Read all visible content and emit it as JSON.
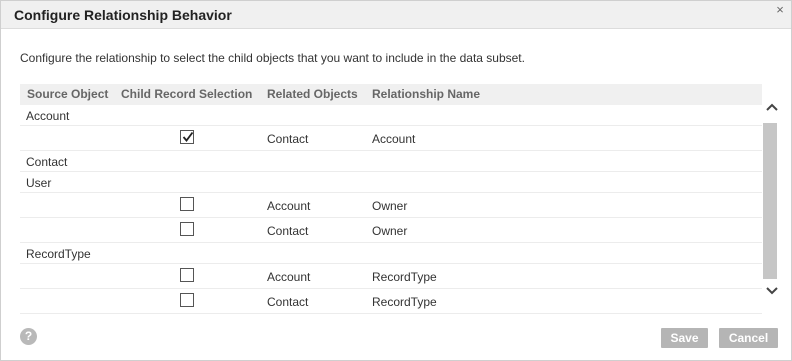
{
  "dialog": {
    "title": "Configure Relationship Behavior",
    "close_glyph": "×",
    "description": "Configure the relationship to select the child objects that you want to include in the data subset."
  },
  "table": {
    "headers": [
      "Source Object",
      "Child Record Selection",
      "Related Objects",
      "Relationship Name"
    ],
    "rows": [
      {
        "type": "source",
        "source": "Account"
      },
      {
        "type": "child",
        "checked": true,
        "related": "Contact",
        "relationship": "Account"
      },
      {
        "type": "source",
        "source": "Contact"
      },
      {
        "type": "source",
        "source": "User"
      },
      {
        "type": "child",
        "checked": false,
        "related": "Account",
        "relationship": "Owner"
      },
      {
        "type": "child",
        "checked": false,
        "related": "Contact",
        "relationship": "Owner"
      },
      {
        "type": "source",
        "source": "RecordType"
      },
      {
        "type": "child",
        "checked": false,
        "related": "Account",
        "relationship": "RecordType"
      },
      {
        "type": "child",
        "checked": false,
        "related": "Contact",
        "relationship": "RecordType"
      }
    ]
  },
  "footer": {
    "help_glyph": "?",
    "save_label": "Save",
    "cancel_label": "Cancel"
  }
}
